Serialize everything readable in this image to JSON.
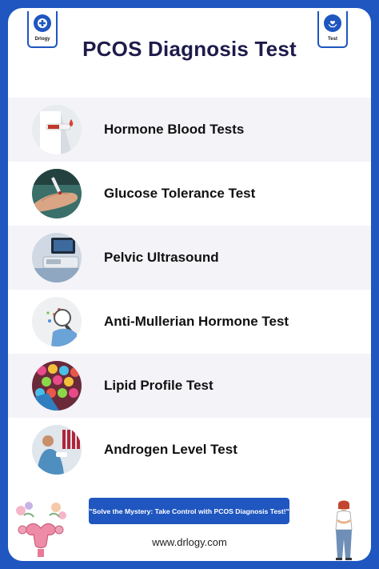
{
  "brand": {
    "left_badge_label": "Drlogy",
    "right_badge_label": "Test",
    "primary_color": "#1f56c0",
    "title_color": "#1e1b4b"
  },
  "page": {
    "title": "PCOS Diagnosis Test"
  },
  "tests": [
    {
      "label": "Hormone Blood Tests",
      "icon": "blood-sample-photo-icon"
    },
    {
      "label": "Glucose Tolerance Test",
      "icon": "finger-prick-photo-icon"
    },
    {
      "label": "Pelvic Ultrasound",
      "icon": "ultrasound-machine-photo-icon"
    },
    {
      "label": "Anti-Mullerian Hormone Test",
      "icon": "magnifier-hormone-photo-icon"
    },
    {
      "label": "Lipid Profile Test",
      "icon": "sample-tubes-photo-icon"
    },
    {
      "label": "Androgen Level Test",
      "icon": "lab-technician-photo-icon"
    }
  ],
  "footer": {
    "cta": "\"Solve the Mystery: Take Control with PCOS Diagnosis Test!\"",
    "website": "www.drlogy.com",
    "left_art": "uterus-flowers-illustration",
    "right_art": "woman-abdominal-pain-illustration"
  }
}
